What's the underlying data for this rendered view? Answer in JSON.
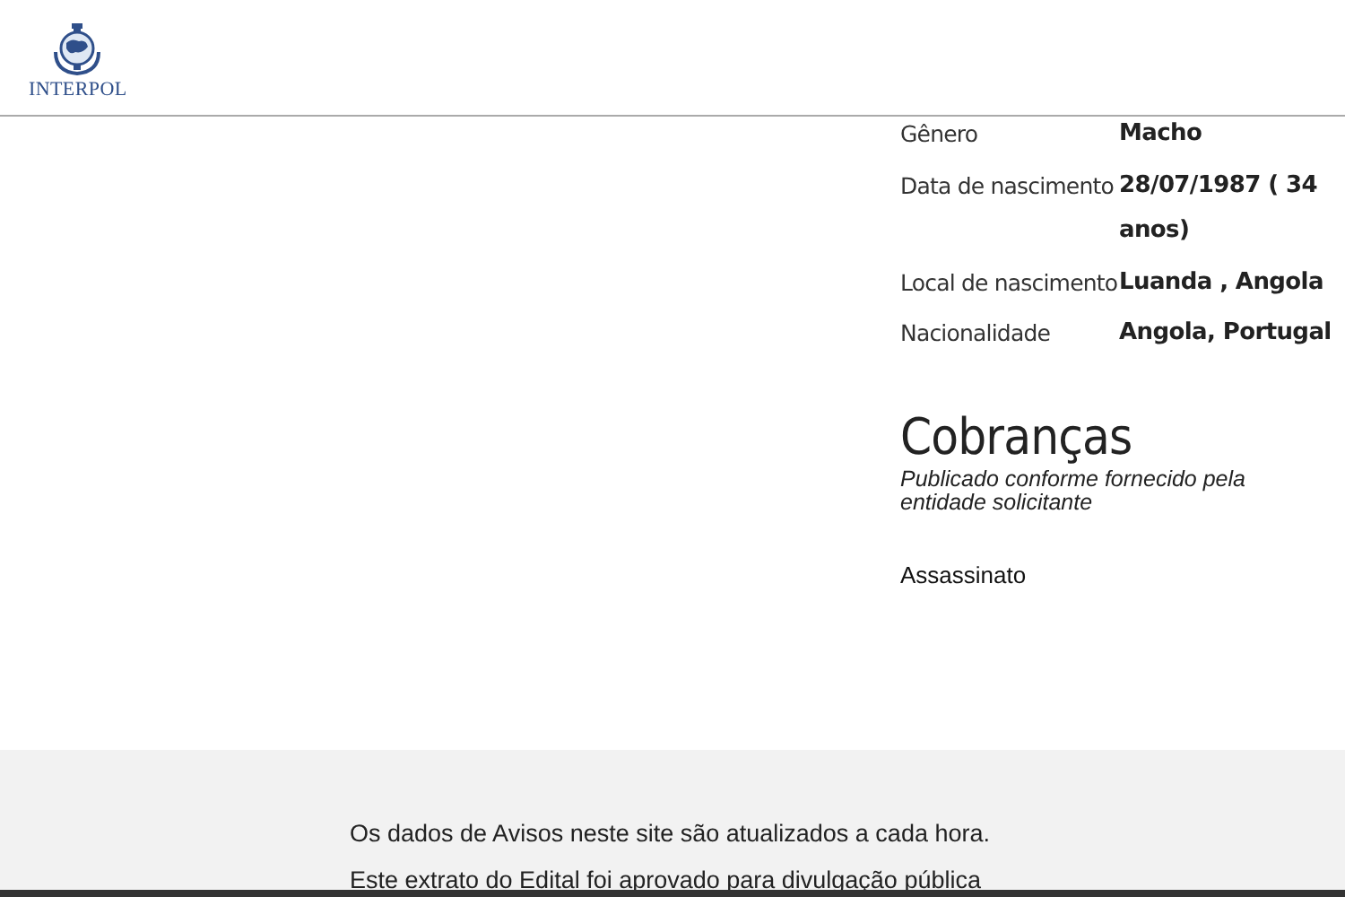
{
  "header": {
    "logo_text": "INTERPOL"
  },
  "details": [
    {
      "label": "Gênero",
      "value": "Macho"
    },
    {
      "label": "Data de nascimento",
      "value": "28/07/1987 ( 34 anos)"
    },
    {
      "label": "Local de nascimento",
      "value": "Luanda , Angola"
    },
    {
      "label": "Nacionalidade",
      "value": "Angola, Portugal"
    }
  ],
  "charges": {
    "title": "Cobranças",
    "note": "Publicado conforme fornecido pela entidade solicitante",
    "items": [
      "Assassinato"
    ]
  },
  "footer": {
    "lines": [
      "Os dados de Avisos neste site são atualizados a cada hora.",
      "Este extrato do Edital foi aprovado para divulgação pública"
    ]
  }
}
